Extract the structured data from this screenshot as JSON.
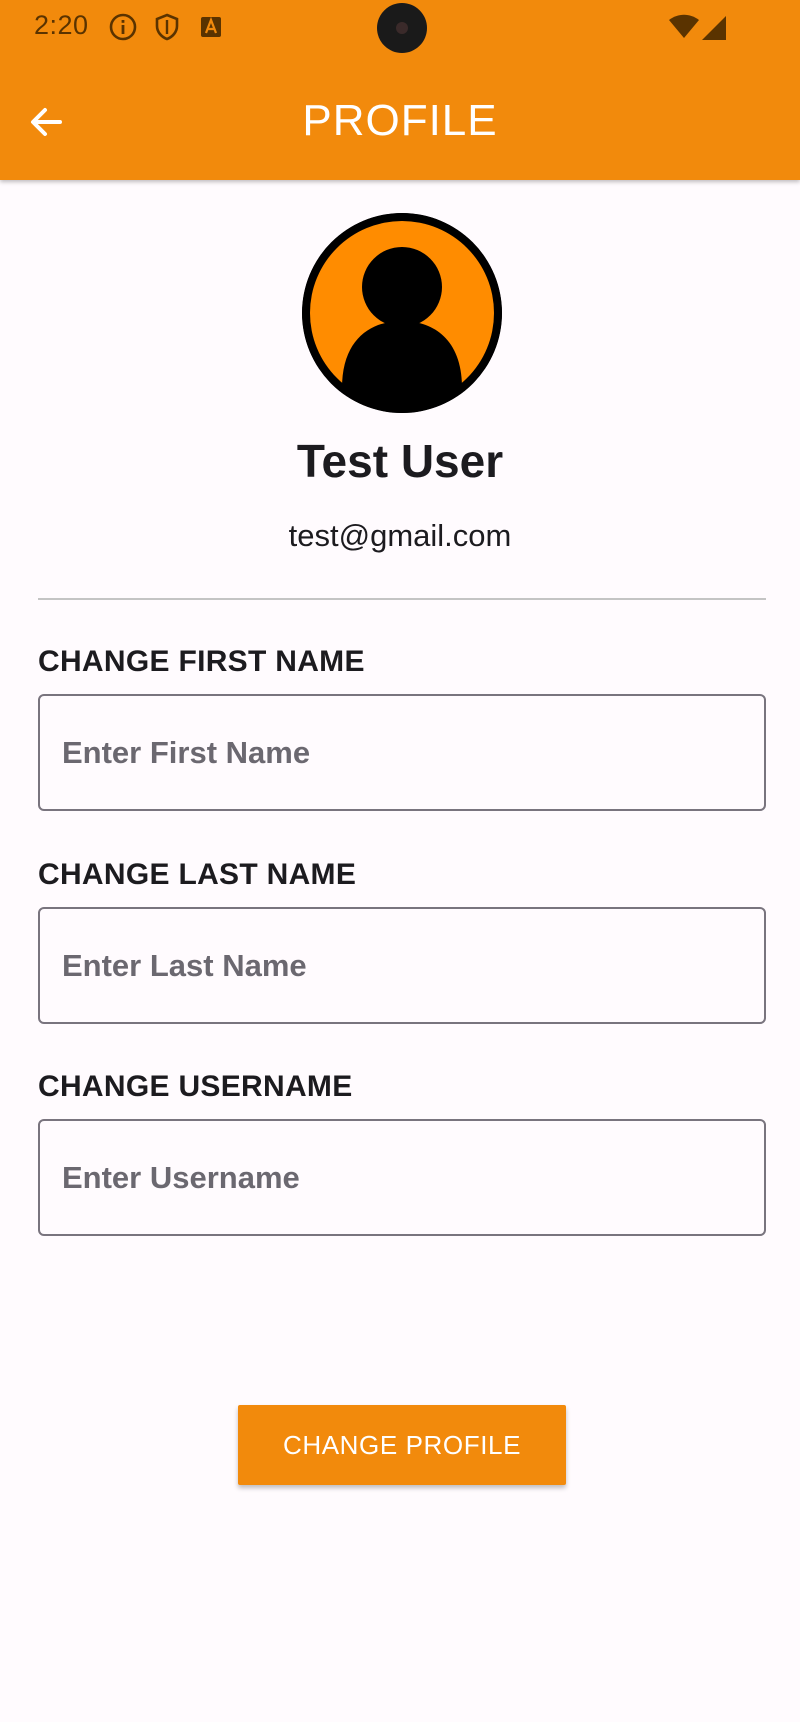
{
  "status_bar": {
    "time": "2:20",
    "icons": [
      "info-icon",
      "shield-icon",
      "keyboard-badge-icon",
      "camera-cutout",
      "wifi-icon",
      "signal-icon"
    ]
  },
  "app_bar": {
    "title": "PROFILE",
    "back_icon": "arrow-left-icon"
  },
  "profile": {
    "avatar_icon": "person-avatar-icon",
    "name": "Test User",
    "email": "test@gmail.com"
  },
  "form": {
    "first_name": {
      "label": "CHANGE FIRST NAME",
      "value": "",
      "placeholder": "Enter First Name"
    },
    "last_name": {
      "label": "CHANGE LAST NAME",
      "value": "",
      "placeholder": "Enter Last Name"
    },
    "username": {
      "label": "CHANGE USERNAME",
      "value": "",
      "placeholder": "Enter Username"
    },
    "submit_label": "CHANGE PROFILE"
  },
  "colors": {
    "accent": "#f28a0c",
    "avatar_fill": "#ff8c00",
    "background": "#fffbfe",
    "text": "#1c1b1f",
    "input_border": "#79747e",
    "placeholder": "#6b6870"
  }
}
